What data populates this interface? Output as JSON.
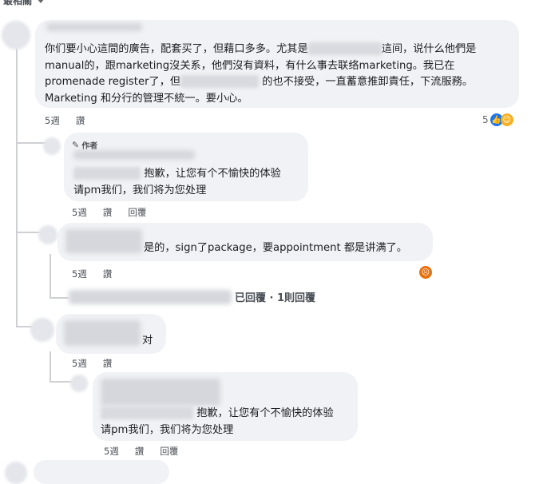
{
  "sort_label": "最相關",
  "comments": [
    {
      "text_a": "你们要小心這間的廣告，配套买了，但藉口多多。尤其是",
      "text_b": "這间，说什么他們是manual的，跟marketing沒关系，他們沒有資料，有什么事去联络marketing。我已在promenade register了，但",
      "text_c": "的也不接受，一直蓄意推卸責任，下流服務。Marketing 和分行的管理不統一。要小心。",
      "time": "5週",
      "like": "讚",
      "reaction_count": "5"
    },
    {
      "badge": "作者",
      "line1": "抱歉，让您有个不愉快的体验",
      "line2": "请pm我们，我们将为您处理",
      "time": "5週",
      "like": "讚",
      "reply": "回覆"
    },
    {
      "text": "是的，sign了package，要appointment 都是讲满了。",
      "time": "5週",
      "like": "讚",
      "replies_summary": "已回覆 · 1則回覆"
    },
    {
      "text": "对",
      "time": "5週",
      "like": "讚"
    },
    {
      "line1": "抱歉，让您有个不愉快的体验",
      "line2": "请pm我们，我们将为您处理",
      "time": "5週",
      "like": "讚",
      "reply": "回覆"
    }
  ],
  "colors": {
    "like_blue": "#1877f2",
    "care_yellow": "#f7b125",
    "angry_red": "#e9710f"
  }
}
